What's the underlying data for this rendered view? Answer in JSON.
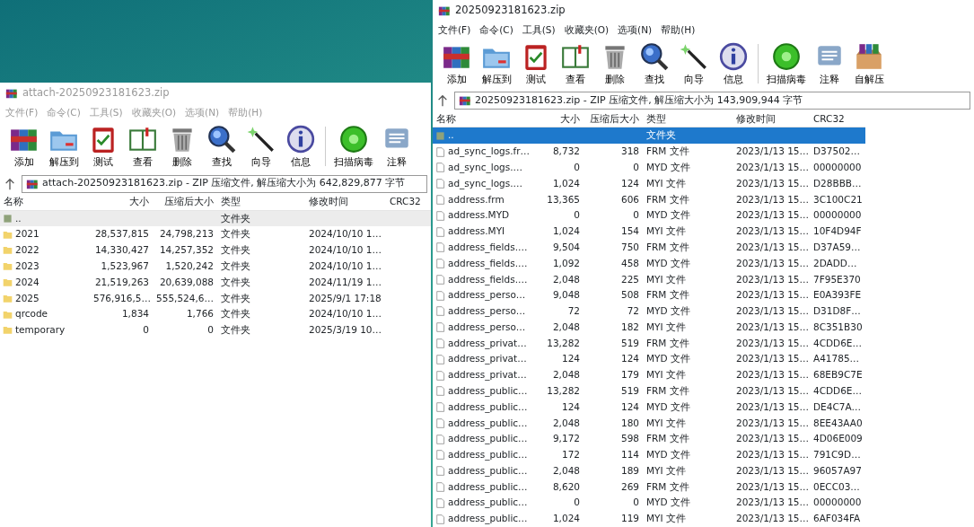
{
  "windows": [
    {
      "title": "20250923181623.zip",
      "active": true,
      "menu": [
        "文件(F)",
        "命令(C)",
        "工具(S)",
        "收藏夹(O)",
        "选项(N)",
        "帮助(H)"
      ],
      "toolbar": [
        {
          "label": "添加",
          "kind": "add"
        },
        {
          "label": "解压到",
          "kind": "extract"
        },
        {
          "label": "测试",
          "kind": "test"
        },
        {
          "label": "查看",
          "kind": "view"
        },
        {
          "label": "删除",
          "kind": "delete"
        },
        {
          "label": "查找",
          "kind": "find"
        },
        {
          "label": "向导",
          "kind": "wizard"
        },
        {
          "label": "信息",
          "kind": "info"
        },
        {
          "label": "扫描病毒",
          "kind": "scan"
        },
        {
          "label": "注释",
          "kind": "comment"
        },
        {
          "label": "自解压",
          "kind": "sfx"
        }
      ],
      "path": "20250923181623.zip - ZIP 压缩文件, 解压缩大小为 143,909,944 字节",
      "columns": [
        "名称",
        "大小",
        "压缩后大小",
        "类型",
        "修改时间",
        "CRC32"
      ],
      "rows": [
        {
          "kind": "parent",
          "selected": true,
          "cells": [
            "..",
            "",
            "",
            "文件夹",
            "",
            ""
          ]
        },
        {
          "kind": "file",
          "selected": false,
          "cells": [
            "ad_sync_logs.fr…",
            "8,732",
            "318",
            "FRM 文件",
            "2023/1/13 15…",
            "D37502…"
          ]
        },
        {
          "kind": "file",
          "selected": false,
          "cells": [
            "ad_sync_logs.…",
            "0",
            "0",
            "MYD 文件",
            "2023/1/13 15…",
            "00000000"
          ]
        },
        {
          "kind": "file",
          "selected": false,
          "cells": [
            "ad_sync_logs.…",
            "1,024",
            "124",
            "MYI 文件",
            "2023/1/13 15…",
            "D28BBB…"
          ]
        },
        {
          "kind": "file",
          "selected": false,
          "cells": [
            "address.frm",
            "13,365",
            "606",
            "FRM 文件",
            "2023/1/13 15…",
            "3C100C21"
          ]
        },
        {
          "kind": "file",
          "selected": false,
          "cells": [
            "address.MYD",
            "0",
            "0",
            "MYD 文件",
            "2023/1/13 15…",
            "00000000"
          ]
        },
        {
          "kind": "file",
          "selected": false,
          "cells": [
            "address.MYI",
            "1,024",
            "154",
            "MYI 文件",
            "2023/1/13 15…",
            "10F4D94F"
          ]
        },
        {
          "kind": "file",
          "selected": false,
          "cells": [
            "address_fields.…",
            "9,504",
            "750",
            "FRM 文件",
            "2023/1/13 15…",
            "D37A59…"
          ]
        },
        {
          "kind": "file",
          "selected": false,
          "cells": [
            "address_fields.…",
            "1,092",
            "458",
            "MYD 文件",
            "2023/1/13 15…",
            "2DADD…"
          ]
        },
        {
          "kind": "file",
          "selected": false,
          "cells": [
            "address_fields.…",
            "2,048",
            "225",
            "MYI 文件",
            "2023/1/13 15…",
            "7F95E370"
          ]
        },
        {
          "kind": "file",
          "selected": false,
          "cells": [
            "address_perso…",
            "9,048",
            "508",
            "FRM 文件",
            "2023/1/13 15…",
            "E0A393FE"
          ]
        },
        {
          "kind": "file",
          "selected": false,
          "cells": [
            "address_perso…",
            "72",
            "72",
            "MYD 文件",
            "2023/1/13 15…",
            "D31D8F…"
          ]
        },
        {
          "kind": "file",
          "selected": false,
          "cells": [
            "address_perso…",
            "2,048",
            "182",
            "MYI 文件",
            "2023/1/13 15…",
            "8C351B30"
          ]
        },
        {
          "kind": "file",
          "selected": false,
          "cells": [
            "address_privat…",
            "13,282",
            "519",
            "FRM 文件",
            "2023/1/13 15…",
            "4CDD6E…"
          ]
        },
        {
          "kind": "file",
          "selected": false,
          "cells": [
            "address_privat…",
            "124",
            "124",
            "MYD 文件",
            "2023/1/13 15…",
            "A41785…"
          ]
        },
        {
          "kind": "file",
          "selected": false,
          "cells": [
            "address_privat…",
            "2,048",
            "179",
            "MYI 文件",
            "2023/1/13 15…",
            "68EB9C7E"
          ]
        },
        {
          "kind": "file",
          "selected": false,
          "cells": [
            "address_public…",
            "13,282",
            "519",
            "FRM 文件",
            "2023/1/13 15…",
            "4CDD6E…"
          ]
        },
        {
          "kind": "file",
          "selected": false,
          "cells": [
            "address_public…",
            "124",
            "124",
            "MYD 文件",
            "2023/1/13 15…",
            "DE4C7A…"
          ]
        },
        {
          "kind": "file",
          "selected": false,
          "cells": [
            "address_public…",
            "2,048",
            "180",
            "MYI 文件",
            "2023/1/13 15…",
            "8EE43AA0"
          ]
        },
        {
          "kind": "file",
          "selected": false,
          "cells": [
            "address_public…",
            "9,172",
            "598",
            "FRM 文件",
            "2023/1/13 15…",
            "4D06E009"
          ]
        },
        {
          "kind": "file",
          "selected": false,
          "cells": [
            "address_public…",
            "172",
            "114",
            "MYD 文件",
            "2023/1/13 15…",
            "791C9D…"
          ]
        },
        {
          "kind": "file",
          "selected": false,
          "cells": [
            "address_public…",
            "2,048",
            "189",
            "MYI 文件",
            "2023/1/13 15…",
            "96057A97"
          ]
        },
        {
          "kind": "file",
          "selected": false,
          "cells": [
            "address_public…",
            "8,620",
            "269",
            "FRM 文件",
            "2023/1/13 15…",
            "0ECC03…"
          ]
        },
        {
          "kind": "file",
          "selected": false,
          "cells": [
            "address_public…",
            "0",
            "0",
            "MYD 文件",
            "2023/1/13 15…",
            "00000000"
          ]
        },
        {
          "kind": "file",
          "selected": false,
          "cells": [
            "address_public…",
            "1,024",
            "119",
            "MYI 文件",
            "2023/1/13 15…",
            "6AF034FA"
          ]
        }
      ]
    },
    {
      "title": "attach-20250923181623.zip",
      "active": false,
      "menu": [
        "文件(F)",
        "命令(C)",
        "工具(S)",
        "收藏夹(O)",
        "选项(N)",
        "帮助(H)"
      ],
      "toolbar": [
        {
          "label": "添加",
          "kind": "add"
        },
        {
          "label": "解压到",
          "kind": "extract"
        },
        {
          "label": "测试",
          "kind": "test"
        },
        {
          "label": "查看",
          "kind": "view"
        },
        {
          "label": "删除",
          "kind": "delete"
        },
        {
          "label": "查找",
          "kind": "find"
        },
        {
          "label": "向导",
          "kind": "wizard"
        },
        {
          "label": "信息",
          "kind": "info"
        },
        {
          "label": "扫描病毒",
          "kind": "scan"
        },
        {
          "label": "注释",
          "kind": "comment"
        }
      ],
      "path": "attach-20250923181623.zip - ZIP 压缩文件, 解压缩大小为 642,829,877 字节",
      "columns": [
        "名称",
        "大小",
        "压缩后大小",
        "类型",
        "修改时间",
        "CRC32"
      ],
      "rows": [
        {
          "kind": "parent",
          "selected": true,
          "cells": [
            "..",
            "",
            "",
            "文件夹",
            "",
            ""
          ]
        },
        {
          "kind": "folder",
          "selected": false,
          "cells": [
            "2021",
            "28,537,815",
            "24,798,213",
            "文件夹",
            "2024/10/10 1…",
            ""
          ]
        },
        {
          "kind": "folder",
          "selected": false,
          "cells": [
            "2022",
            "14,330,427",
            "14,257,352",
            "文件夹",
            "2024/10/10 1…",
            ""
          ]
        },
        {
          "kind": "folder",
          "selected": false,
          "cells": [
            "2023",
            "1,523,967",
            "1,520,242",
            "文件夹",
            "2024/10/10 1…",
            ""
          ]
        },
        {
          "kind": "folder",
          "selected": false,
          "cells": [
            "2024",
            "21,519,263",
            "20,639,088",
            "文件夹",
            "2024/11/19 1…",
            ""
          ]
        },
        {
          "kind": "folder",
          "selected": false,
          "cells": [
            "2025",
            "576,916,5…",
            "555,524,6…",
            "文件夹",
            "2025/9/1 17:18",
            ""
          ]
        },
        {
          "kind": "folder",
          "selected": false,
          "cells": [
            "qrcode",
            "1,834",
            "1,766",
            "文件夹",
            "2024/10/10 1…",
            ""
          ]
        },
        {
          "kind": "folder",
          "selected": false,
          "cells": [
            "temporary",
            "0",
            "0",
            "文件夹",
            "2025/3/19 10…",
            ""
          ]
        }
      ]
    }
  ]
}
